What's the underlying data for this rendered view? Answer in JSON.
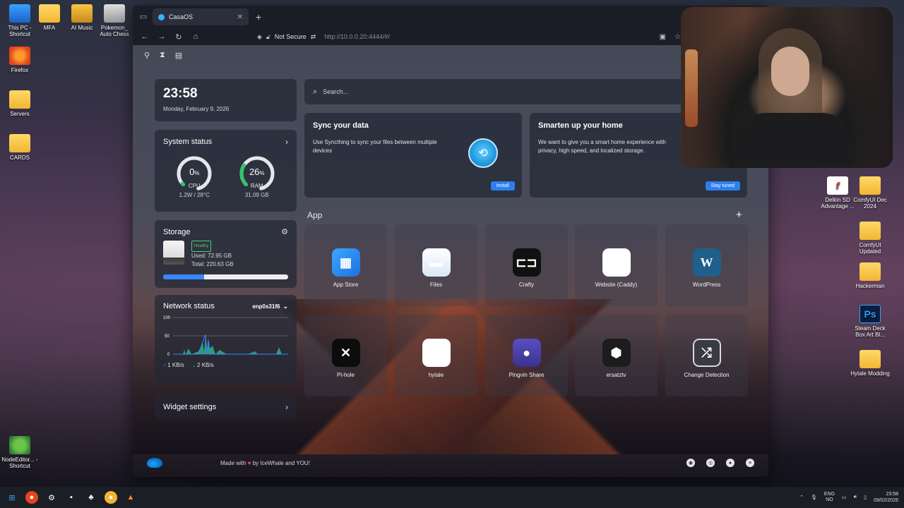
{
  "desktop": {
    "left_icons": [
      {
        "label": "This PC - Shortcut",
        "icon": "pc-icon"
      },
      {
        "label": "MFA",
        "icon": "folder-icon"
      },
      {
        "label": "AI Music",
        "icon": "folder-icon"
      },
      {
        "label": "Pokemon_ Auto Chess",
        "icon": "pokemon-icon"
      },
      {
        "label": "Firefox",
        "icon": "firefox-icon"
      },
      {
        "label": "Servers",
        "icon": "folder-icon"
      },
      {
        "label": "CARDS",
        "icon": "folder-icon"
      },
      {
        "label": "NodeEditor... - Shortcut",
        "icon": "node-icon"
      }
    ],
    "right_icons": [
      {
        "label": "Delkin SD Advantage ...",
        "icon": "app-icon"
      },
      {
        "label": "ComfyUI Dec 2024",
        "icon": "folder-icon"
      },
      {
        "label": "ComfyUI Updated",
        "icon": "folder-icon"
      },
      {
        "label": "Hackerman",
        "icon": "folder-icon"
      },
      {
        "label": "Steam Deck Box Art Bl...",
        "icon": "photoshop-icon"
      },
      {
        "label": "Hytale Modding",
        "icon": "folder-icon"
      }
    ]
  },
  "browser": {
    "tab_title": "CasaOS",
    "security": "Not Secure",
    "url": "http://10.0.0.20:4444/#/"
  },
  "casa": {
    "time": "23:58",
    "date": "Monday, February 9, 2026",
    "system_status": {
      "title": "System status",
      "cpu": {
        "value": "0",
        "unit": "%",
        "label": "CPU",
        "sub": "1.2W / 28°C",
        "fraction": 0.0
      },
      "ram": {
        "value": "26",
        "unit": "%",
        "label": "RAM",
        "sub": "31.09 GB",
        "fraction": 0.26
      }
    },
    "storage": {
      "title": "Storage",
      "badge": "Healthy",
      "used": "Used: 72.95 GB",
      "total": "Total: 220.63 GB",
      "used_fraction": 0.33
    },
    "network": {
      "title": "Network status",
      "interface": "enp0s31f6",
      "ticks": [
        "100",
        "50",
        "0"
      ],
      "upload": "1 KB/s",
      "download": "2 KB/s"
    },
    "widget_settings": "Widget settings",
    "search_placeholder": "Search...",
    "promos": [
      {
        "title": "Sync your data",
        "desc": "Use Syncthing to sync your files between multiple devices",
        "button": "Install"
      },
      {
        "title": "Smarten up your home",
        "desc": "We want to give you a smart home experience with privacy, high speed, and localized storage.",
        "button": "Stay tuned"
      }
    ],
    "apps_title": "App",
    "apps": [
      {
        "name": "App Store",
        "glyph": "▦",
        "cls": "ic-store"
      },
      {
        "name": "Files",
        "glyph": "▬",
        "cls": "ic-files"
      },
      {
        "name": "Crafty",
        "glyph": "⊏⊐",
        "cls": "ic-crafty"
      },
      {
        "name": "Website (Caddy)",
        "glyph": "⬢",
        "cls": "ic-caddy"
      },
      {
        "name": "WordPress",
        "glyph": "W",
        "cls": "ic-wp"
      },
      {
        "name": "Pi-hole",
        "glyph": "✕",
        "cls": "ic-pihole"
      },
      {
        "name": "hytale",
        "glyph": "⬢",
        "cls": "ic-hytale"
      },
      {
        "name": "Pingvin Share",
        "glyph": "●",
        "cls": "ic-pingvin"
      },
      {
        "name": "ersatztv",
        "glyph": "⬢",
        "cls": "ic-ersatz"
      },
      {
        "name": "Change Detection",
        "glyph": "⤮",
        "cls": "ic-change"
      }
    ],
    "footer": {
      "made_prefix": "Made with",
      "made_suffix": "by IceWhale and YOU!"
    }
  },
  "taskbar": {
    "lang_top": "ENG",
    "lang_bottom": "NO",
    "time": "23:58",
    "date": "09/02/2026"
  }
}
